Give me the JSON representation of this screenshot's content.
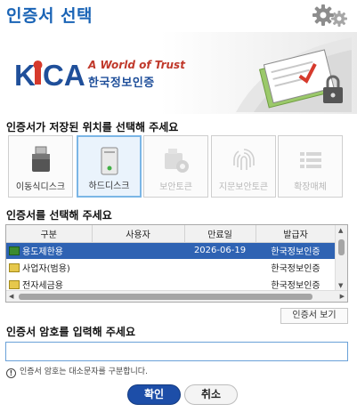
{
  "window": {
    "title": "인증서 선택"
  },
  "banner": {
    "logo_text": "KICA",
    "slogan": "A World of Trust",
    "org_name": "한국정보인증"
  },
  "location": {
    "heading": "인증서가 저장된 위치를 선택해 주세요",
    "devices": [
      {
        "label": "이동식디스크",
        "state": "enabled"
      },
      {
        "label": "하드디스크",
        "state": "selected"
      },
      {
        "label": "보안토큰",
        "state": "disabled"
      },
      {
        "label": "지문보안토큰",
        "state": "disabled"
      },
      {
        "label": "확장매체",
        "state": "disabled"
      }
    ]
  },
  "certs": {
    "heading": "인증서를 선택해 주세요",
    "columns": [
      "구분",
      "사용자",
      "만료일",
      "발급자"
    ],
    "rows": [
      {
        "type": "용도제한용",
        "user": "",
        "expiry": "2026-06-19",
        "issuer": "한국정보인증",
        "selected": true
      },
      {
        "type": "사업자(범용)",
        "user": "",
        "expiry": "",
        "issuer": "한국정보인증",
        "selected": false
      },
      {
        "type": "전자세금용",
        "user": "",
        "expiry": "",
        "issuer": "한국정보인증",
        "selected": false
      }
    ],
    "view_button": "인증서 보기"
  },
  "password": {
    "heading": "인증서 암호를 입력해 주세요",
    "value": "",
    "hint": "인증서 암호는 대소문자를 구분합니다."
  },
  "actions": {
    "ok": "확인",
    "cancel": "취소"
  },
  "colors": {
    "accent": "#1a64b6",
    "selection": "#2f63b3",
    "logo_red": "#d63a2c",
    "logo_blue": "#1f4f9a"
  },
  "icons": {
    "settings": "gear-icon",
    "devices": [
      "usb-drive-icon",
      "hard-disk-icon",
      "security-token-icon",
      "fingerprint-icon",
      "list-icon"
    ],
    "hint": "exclamation-icon"
  }
}
